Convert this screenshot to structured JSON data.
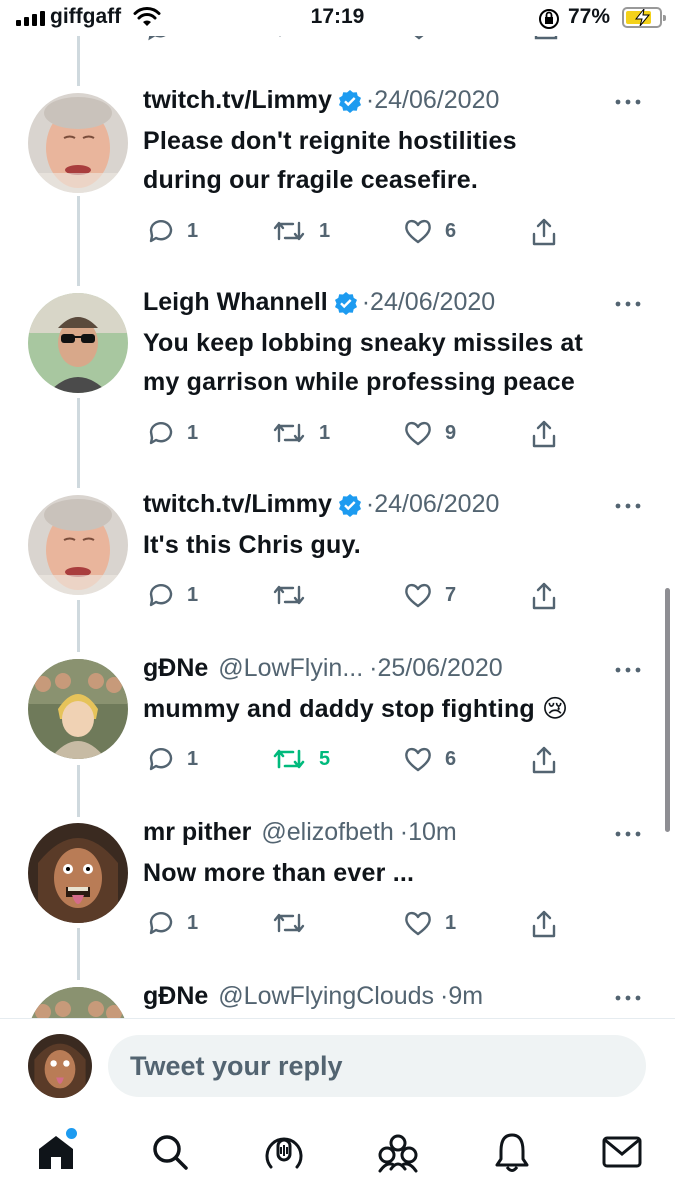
{
  "status_bar": {
    "carrier": "giffgaff",
    "time": "17:19",
    "battery_percent": "77%",
    "battery_level": 0.77,
    "battery_color": "#f4d21a"
  },
  "tweets": [
    {
      "name": "twitch.tv/Limmy",
      "verified": true,
      "handle": "",
      "separator": "·",
      "date": "24/06/2020",
      "text_lines": [
        "Please don't reignite hostilities",
        "during our fragile ceasefire."
      ],
      "replies": "1",
      "retweets": "1",
      "likes": "6",
      "retweeted": false
    },
    {
      "name": "Leigh Whannell",
      "verified": true,
      "handle": "",
      "separator": "·",
      "date": "24/06/2020",
      "text_lines": [
        "You keep lobbing sneaky missiles at",
        "my garrison while professing peace"
      ],
      "replies": "1",
      "retweets": "1",
      "likes": "9",
      "retweeted": false
    },
    {
      "name": "twitch.tv/Limmy",
      "verified": true,
      "handle": "",
      "separator": "·",
      "date": "24/06/2020",
      "text_lines": [
        "It's this Chris guy."
      ],
      "replies": "1",
      "retweets": "",
      "likes": "7",
      "retweeted": false
    },
    {
      "name": "gƉNe",
      "verified": false,
      "handle": "@LowFlyin...",
      "separator": "·",
      "date": "25/06/2020",
      "text_lines": [
        "mummy and daddy stop fighting 😢"
      ],
      "replies": "1",
      "retweets": "5",
      "likes": "6",
      "retweeted": true
    },
    {
      "name": "mr pither",
      "verified": false,
      "handle": "@elizofbeth",
      "separator": "·",
      "date": "10m",
      "text_lines": [
        "Now more than ever ..."
      ],
      "replies": "1",
      "retweets": "",
      "likes": "1",
      "retweeted": false
    },
    {
      "name": "gƉNe",
      "verified": false,
      "handle": "@LowFlyingClouds",
      "separator": "·",
      "date": "9m",
      "text_lines": [],
      "replies": "",
      "retweets": "",
      "likes": "",
      "retweeted": false
    }
  ],
  "reply_bar": {
    "placeholder": "Tweet your reply"
  },
  "tab_bar": {
    "items": [
      "home-icon",
      "search-icon",
      "spaces-icon",
      "communities-icon",
      "notifications-icon",
      "messages-icon"
    ],
    "home_has_notification": true
  },
  "colors": {
    "accent": "#1d9bf0",
    "retweet_active": "#00ba7c",
    "secondary_text": "#536471"
  }
}
